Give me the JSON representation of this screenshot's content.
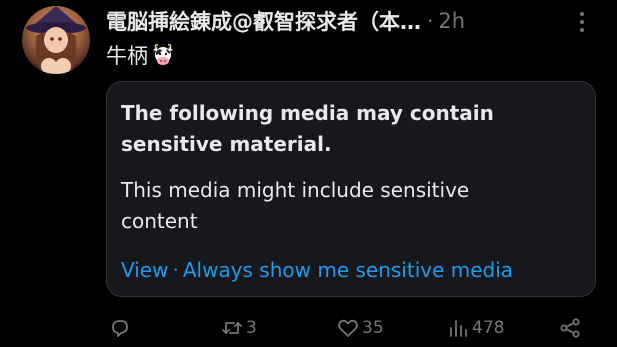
{
  "post": {
    "author": {
      "display_name": "電脳挿絵錬成@叡智探求者（本…"
    },
    "separator": "·",
    "timestamp": "2h",
    "text": "牛柄",
    "emoji": "cow-face-emoji"
  },
  "sensitive_media": {
    "title": "The following media may contain sensitive material.",
    "description": "This media might include sensitive content",
    "view_label": "View",
    "action_separator": "·",
    "always_show_label": "Always show me sensitive media"
  },
  "actions": {
    "reply_count": "",
    "repost_count": "3",
    "like_count": "35",
    "view_count": "478"
  },
  "icons": {
    "more": "more-vertical-icon",
    "reply": "reply-icon",
    "repost": "repost-icon",
    "like": "heart-icon",
    "views": "views-bar-chart-icon",
    "share": "share-icon"
  },
  "colors": {
    "background": "#000000",
    "primary_text": "#e7e9ea",
    "secondary_text": "#71767b",
    "link": "#1d9bf0",
    "card_background": "#16181c",
    "card_border": "#2f3336"
  }
}
